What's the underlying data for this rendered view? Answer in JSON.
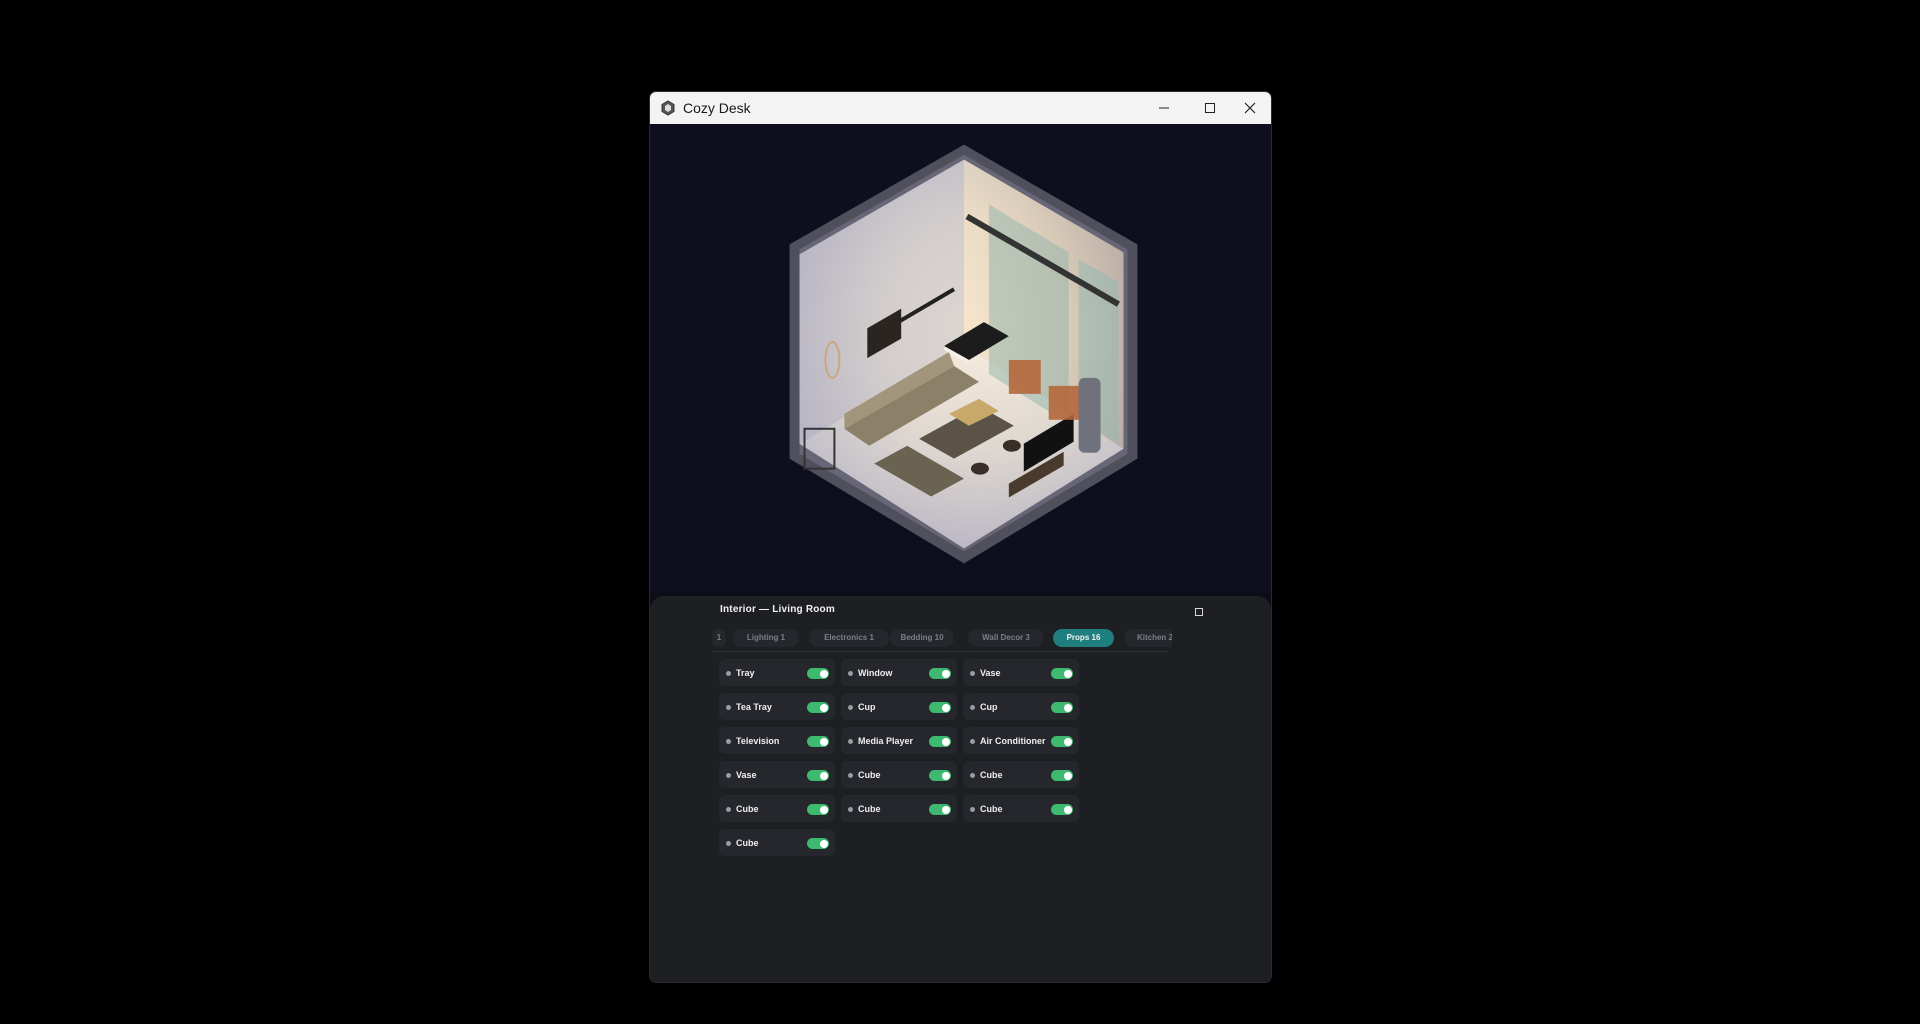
{
  "window": {
    "title": "Cozy Desk"
  },
  "panel": {
    "title": "Interior — Living Room"
  },
  "tabs": [
    {
      "label": "1",
      "active": false
    },
    {
      "label": "Lighting 1",
      "active": false
    },
    {
      "label": "Electronics 1",
      "active": false
    },
    {
      "label": "Bedding 10",
      "active": false
    },
    {
      "label": "Wall Decor 3",
      "active": false
    },
    {
      "label": "Props 16",
      "active": true
    },
    {
      "label": "Kitchen 2",
      "active": false
    }
  ],
  "items": [
    {
      "label": "Tray",
      "on": true
    },
    {
      "label": "Window",
      "on": true
    },
    {
      "label": "Vase",
      "on": true
    },
    {
      "label": "Tea Tray",
      "on": true
    },
    {
      "label": "Cup",
      "on": true
    },
    {
      "label": "Cup",
      "on": true
    },
    {
      "label": "Television",
      "on": true
    },
    {
      "label": "Media Player",
      "on": true
    },
    {
      "label": "Air Conditioner",
      "on": true
    },
    {
      "label": "Vase",
      "on": true
    },
    {
      "label": "Cube",
      "on": true
    },
    {
      "label": "Cube",
      "on": true
    },
    {
      "label": "Cube",
      "on": true
    },
    {
      "label": "Cube",
      "on": true
    },
    {
      "label": "Cube",
      "on": true
    },
    {
      "label": "Cube",
      "on": true
    }
  ],
  "colors": {
    "accent": "#1f7f7f",
    "toggle_on": "#3dba6f",
    "panel_bg": "#1e1f23",
    "scene_bg": "#0f0e1e"
  },
  "icons": {
    "app": "hexagon-logo-icon",
    "minimize": "minimize-icon",
    "maximize": "maximize-icon",
    "close": "close-icon",
    "expand": "expand-icon"
  }
}
